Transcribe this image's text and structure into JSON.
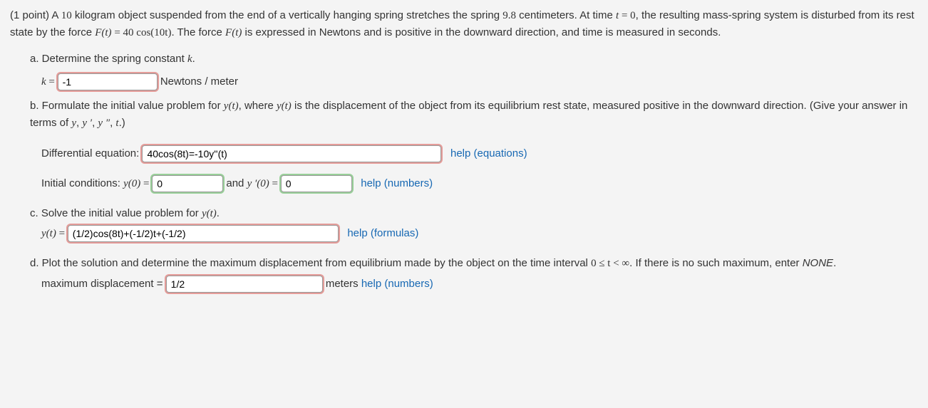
{
  "intro": {
    "points": "(1 point)",
    "t1": " A ",
    "n_mass": "10",
    "t2": " kilogram object suspended from the end of a vertically hanging spring stretches the spring ",
    "n_stretch": "9.8",
    "t3": " centimeters. At time ",
    "eq_t0_lhs": "t",
    "eq_t0_eq": " = ",
    "eq_t0_rhs": "0",
    "t4": ", the resulting mass-spring system is disturbed from its rest state by the force ",
    "force_lhs": "F(t)",
    "force_eq": " = ",
    "force_rhs": "40 cos(10t)",
    "t5": ". The force ",
    "force2": "F(t)",
    "t6": " is expressed in Newtons and is positive in the downward direction, and time is measured in seconds."
  },
  "a": {
    "label": "a. Determine the spring constant ",
    "kvar": "k",
    "period": ".",
    "klabel": "k",
    "eq": " = ",
    "value": "-1",
    "unit": "Newtons / meter"
  },
  "b": {
    "label_1": "b. Formulate the initial value problem for ",
    "yt": "y(t)",
    "label_2": ", where ",
    "yt2": "y(t)",
    "label_3": " is the displacement of the object from its equilibrium rest state, measured positive in the downward direction. (Give your answer in terms of ",
    "terms1": "y",
    "comma1": ", ",
    "terms2": "y ′",
    "comma2": ", ",
    "terms3": "y ″",
    "comma3": ", ",
    "terms4": "t",
    "period": ".)",
    "de_label": "Differential equation:  ",
    "de_value": "40cos(8t)=-10y''(t)",
    "de_help": "help (equations)",
    "ic_label": "Initial conditions: ",
    "ic_y0_lhs": "y(0)",
    "ic_eq": " = ",
    "ic_y0_value": "0",
    "ic_and": " and ",
    "ic_yp0_lhs": "y ′(0)",
    "ic_yp0_value": "0",
    "ic_help": "help (numbers)"
  },
  "c": {
    "label": "c. Solve the initial value problem for ",
    "yt": "y(t)",
    "period": ".",
    "yt_lhs": "y(t)",
    "eq": " = ",
    "value": "(1/2)cos(8t)+(-1/2)t+(-1/2)",
    "help": "help (formulas)"
  },
  "d": {
    "label_1": "d. Plot the solution and determine the maximum displacement from equilibrium made by the object on the time interval ",
    "range": "0 ≤ t < ∞",
    "label_2": ". If there is no such maximum, enter ",
    "none": "NONE",
    "period": ".",
    "max_label": "maximum displacement = ",
    "max_value": "1/2",
    "max_unit": "meters",
    "max_help": "help (numbers)"
  }
}
